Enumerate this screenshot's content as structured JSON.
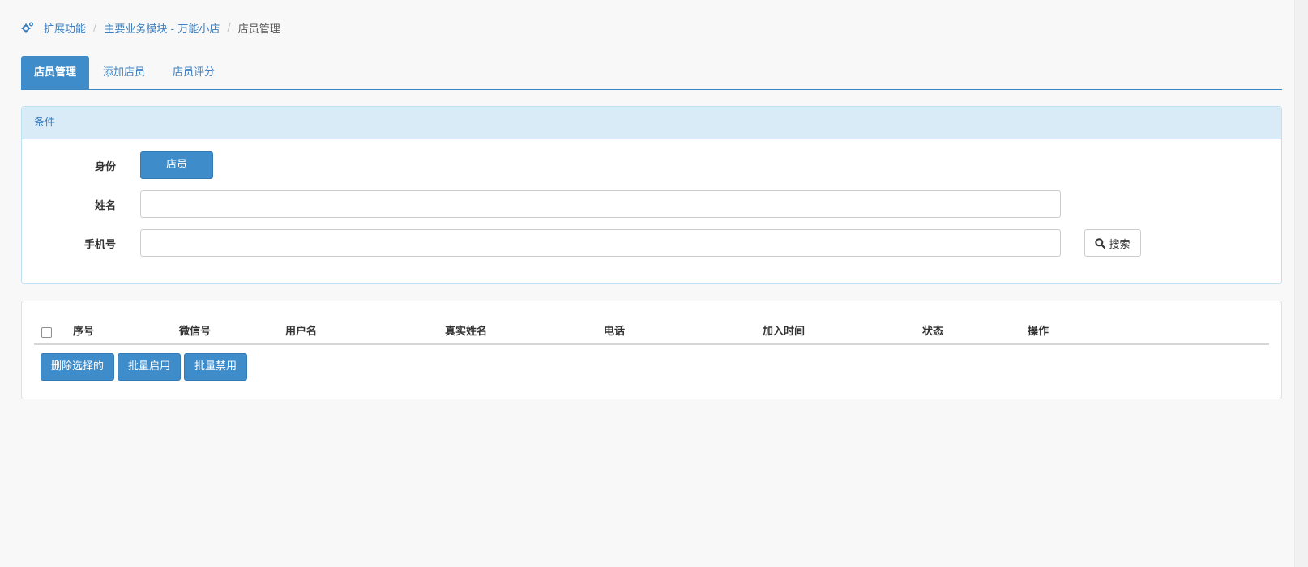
{
  "breadcrumb": {
    "icon": "gears-icon",
    "items": [
      "扩展功能",
      "主要业务模块 - 万能小店"
    ],
    "current": "店员管理",
    "separator": "/"
  },
  "tabs": [
    {
      "label": "店员管理",
      "active": true
    },
    {
      "label": "添加店员",
      "active": false
    },
    {
      "label": "店员评分",
      "active": false
    }
  ],
  "filter": {
    "title": "条件",
    "identity_label": "身份",
    "identity_value": "店员",
    "name_label": "姓名",
    "name_value": "",
    "phone_label": "手机号",
    "phone_value": "",
    "search_label": "搜索",
    "search_icon": "search-icon"
  },
  "table": {
    "columns": [
      "序号",
      "微信号",
      "用户名",
      "真实姓名",
      "电话",
      "加入时间",
      "状态",
      "操作"
    ],
    "rows": []
  },
  "bulk_actions": [
    "删除选择的",
    "批量启用",
    "批量禁用"
  ],
  "colors": {
    "primary": "#3f8ccb",
    "link": "#3c7fbf",
    "panel_head": "#d9ebf6"
  }
}
